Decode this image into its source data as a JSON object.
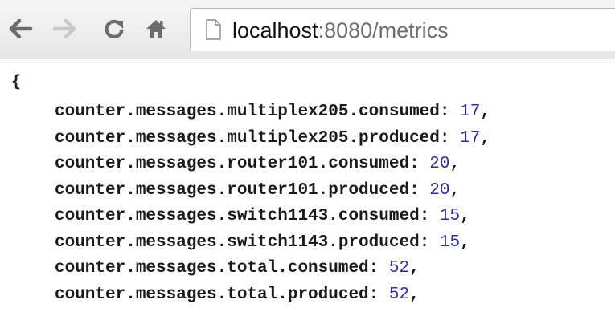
{
  "toolbar": {
    "back_icon": "back-arrow-icon",
    "forward_icon": "forward-arrow-icon",
    "reload_icon": "reload-icon",
    "home_icon": "home-icon",
    "page_icon": "page-icon"
  },
  "address_bar": {
    "host": "localhost",
    "rest": ":8080/metrics"
  },
  "content": {
    "open_brace": "{",
    "entries": [
      {
        "key": "counter.messages.multiplex205.consumed",
        "value": "17"
      },
      {
        "key": "counter.messages.multiplex205.produced",
        "value": "17"
      },
      {
        "key": "counter.messages.router101.consumed",
        "value": "20"
      },
      {
        "key": "counter.messages.router101.produced",
        "value": "20"
      },
      {
        "key": "counter.messages.switch1143.consumed",
        "value": "15"
      },
      {
        "key": "counter.messages.switch1143.produced",
        "value": "15"
      },
      {
        "key": "counter.messages.total.consumed",
        "value": "52"
      },
      {
        "key": "counter.messages.total.produced",
        "value": "52"
      }
    ]
  },
  "colors": {
    "value_color": "#2d2d9e",
    "key_color": "#1a1a1a",
    "toolbar_bg": "#ececec"
  }
}
